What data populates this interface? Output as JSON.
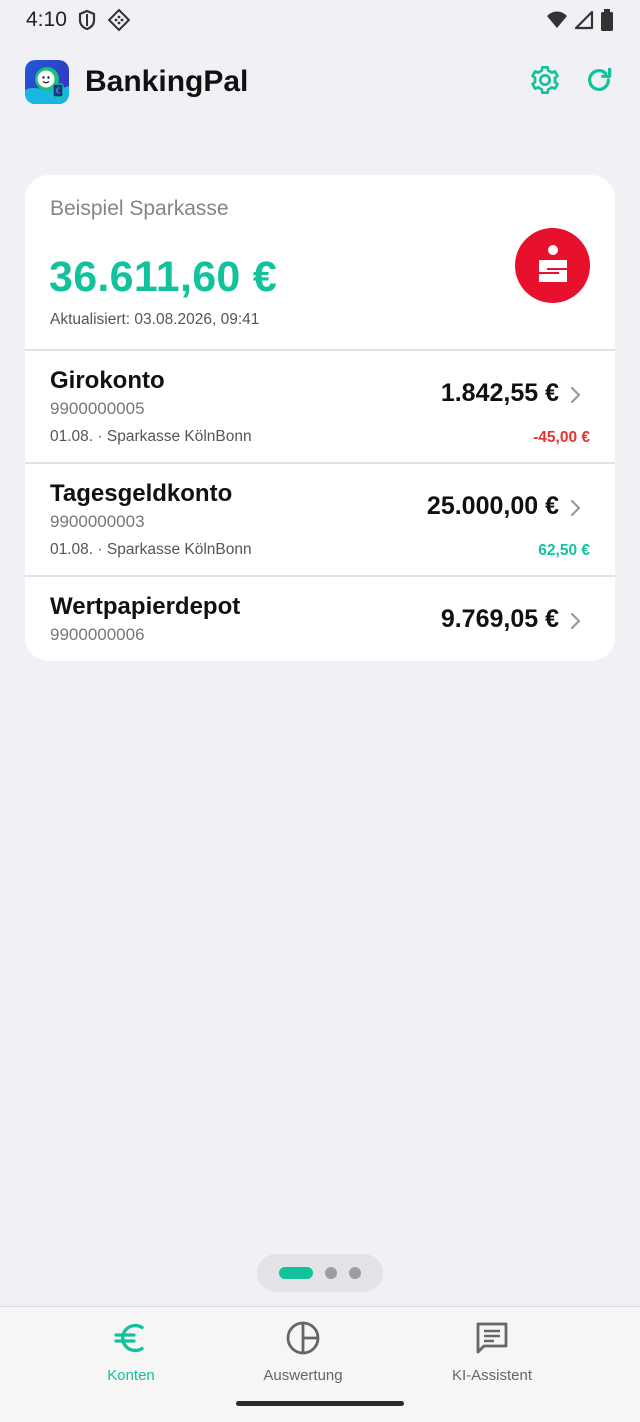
{
  "status_bar": {
    "time": "4:10"
  },
  "app": {
    "title": "BankingPal",
    "accent_color": "#12C29D"
  },
  "bank": {
    "name": "Beispiel Sparkasse",
    "total": "36.611,60 €",
    "updated": "Aktualisiert: 03.08.2026, 09:41",
    "logo_icon": "sparkasse-logo-icon",
    "logo_color": "#E8112D"
  },
  "accounts": [
    {
      "name": "Girokonto",
      "number": "9900000005",
      "balance": "1.842,55 €",
      "meta": "01.08. · Sparkasse KölnBonn",
      "change": "-45,00 €",
      "change_color": "#E5332E"
    },
    {
      "name": "Tagesgeldkonto",
      "number": "9900000003",
      "balance": "25.000,00 €",
      "meta": "01.08. · Sparkasse KölnBonn",
      "change": "62,50 €",
      "change_color": "#12C29D"
    },
    {
      "name": "Wertpapierdepot",
      "number": "9900000006",
      "balance": "9.769,05 €"
    }
  ],
  "page_indicator": {
    "pages": 3,
    "active": 1
  },
  "nav": {
    "items": [
      {
        "label": "Konten",
        "icon": "euro-icon",
        "active": true
      },
      {
        "label": "Auswertung",
        "icon": "pie-chart-icon",
        "active": false
      },
      {
        "label": "KI-Assistent",
        "icon": "chat-icon",
        "active": false
      }
    ]
  }
}
